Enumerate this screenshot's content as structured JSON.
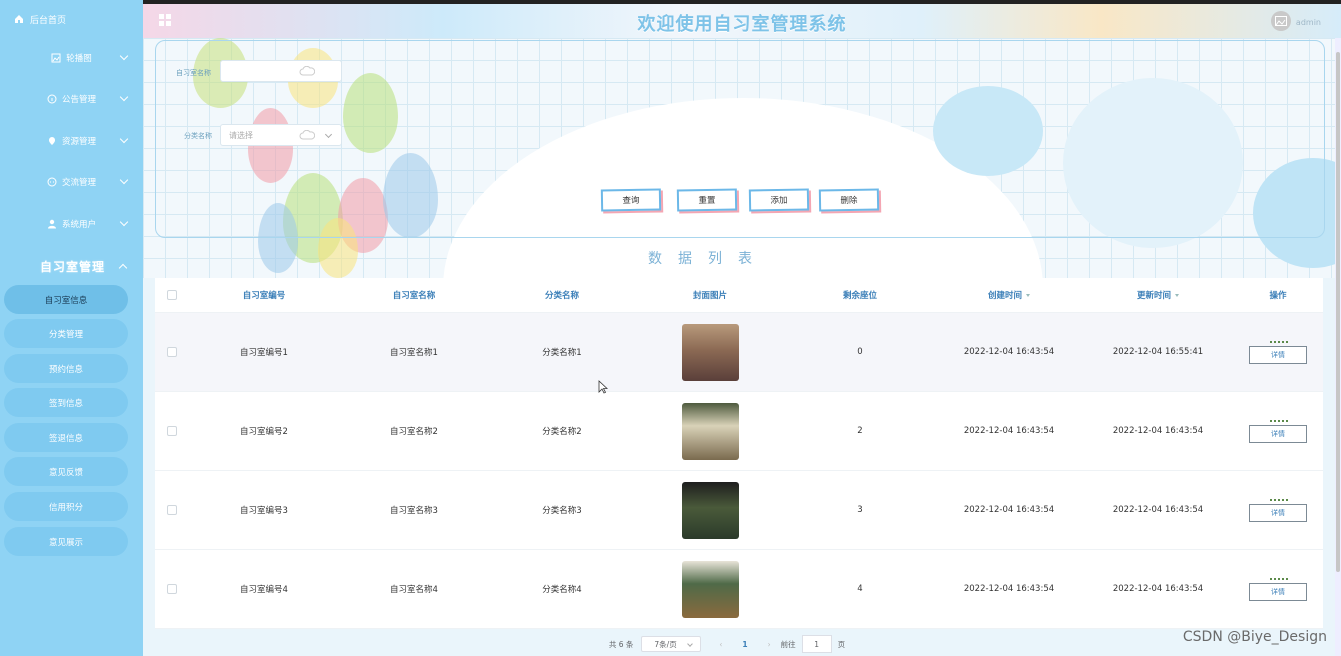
{
  "sidebar": {
    "home": "后台首页",
    "menus": [
      {
        "label": "轮播图",
        "icon": "image-icon"
      },
      {
        "label": "公告管理",
        "icon": "info-icon"
      },
      {
        "label": "资源管理",
        "icon": "pin-icon"
      },
      {
        "label": "交流管理",
        "icon": "chat-icon"
      },
      {
        "label": "系统用户",
        "icon": "user-icon"
      }
    ],
    "group_title": "自习室管理",
    "submenu": [
      "自习室信息",
      "分类管理",
      "预约信息",
      "签到信息",
      "签退信息",
      "意见反馈",
      "信用积分",
      "意见展示"
    ]
  },
  "header": {
    "title": "欢迎使用自习室管理系统",
    "user": "admin"
  },
  "search": {
    "field1_label": "自习室名称",
    "field2_label": "分类名称",
    "field2_placeholder": "请选择",
    "buttons": [
      "查询",
      "重置",
      "添加",
      "删除"
    ]
  },
  "list_title": "数据列表",
  "table": {
    "columns": [
      "自习室编号",
      "自习室名称",
      "分类名称",
      "封面图片",
      "剩余座位",
      "创建时间",
      "更新时间",
      "操作"
    ],
    "rows": [
      {
        "no": "自习室编号1",
        "name": "自习室名称1",
        "cat": "分类名称1",
        "seat": "0",
        "ct": "2022-12-04 16:43:54",
        "ut": "2022-12-04 16:55:41",
        "op": "详情"
      },
      {
        "no": "自习室编号2",
        "name": "自习室名称2",
        "cat": "分类名称2",
        "seat": "2",
        "ct": "2022-12-04 16:43:54",
        "ut": "2022-12-04 16:43:54",
        "op": "详情"
      },
      {
        "no": "自习室编号3",
        "name": "自习室名称3",
        "cat": "分类名称3",
        "seat": "3",
        "ct": "2022-12-04 16:43:54",
        "ut": "2022-12-04 16:43:54",
        "op": "详情"
      },
      {
        "no": "自习室编号4",
        "name": "自习室名称4",
        "cat": "分类名称4",
        "seat": "4",
        "ct": "2022-12-04 16:43:54",
        "ut": "2022-12-04 16:43:54",
        "op": "详情"
      }
    ]
  },
  "pager": {
    "total": "共 6 条",
    "page_size": "7条/页",
    "current": "1",
    "goto": "前往",
    "goto_value": "1",
    "page_unit": "页",
    "prev": "‹",
    "next": "›"
  },
  "watermark": "CSDN @Biye_Design"
}
